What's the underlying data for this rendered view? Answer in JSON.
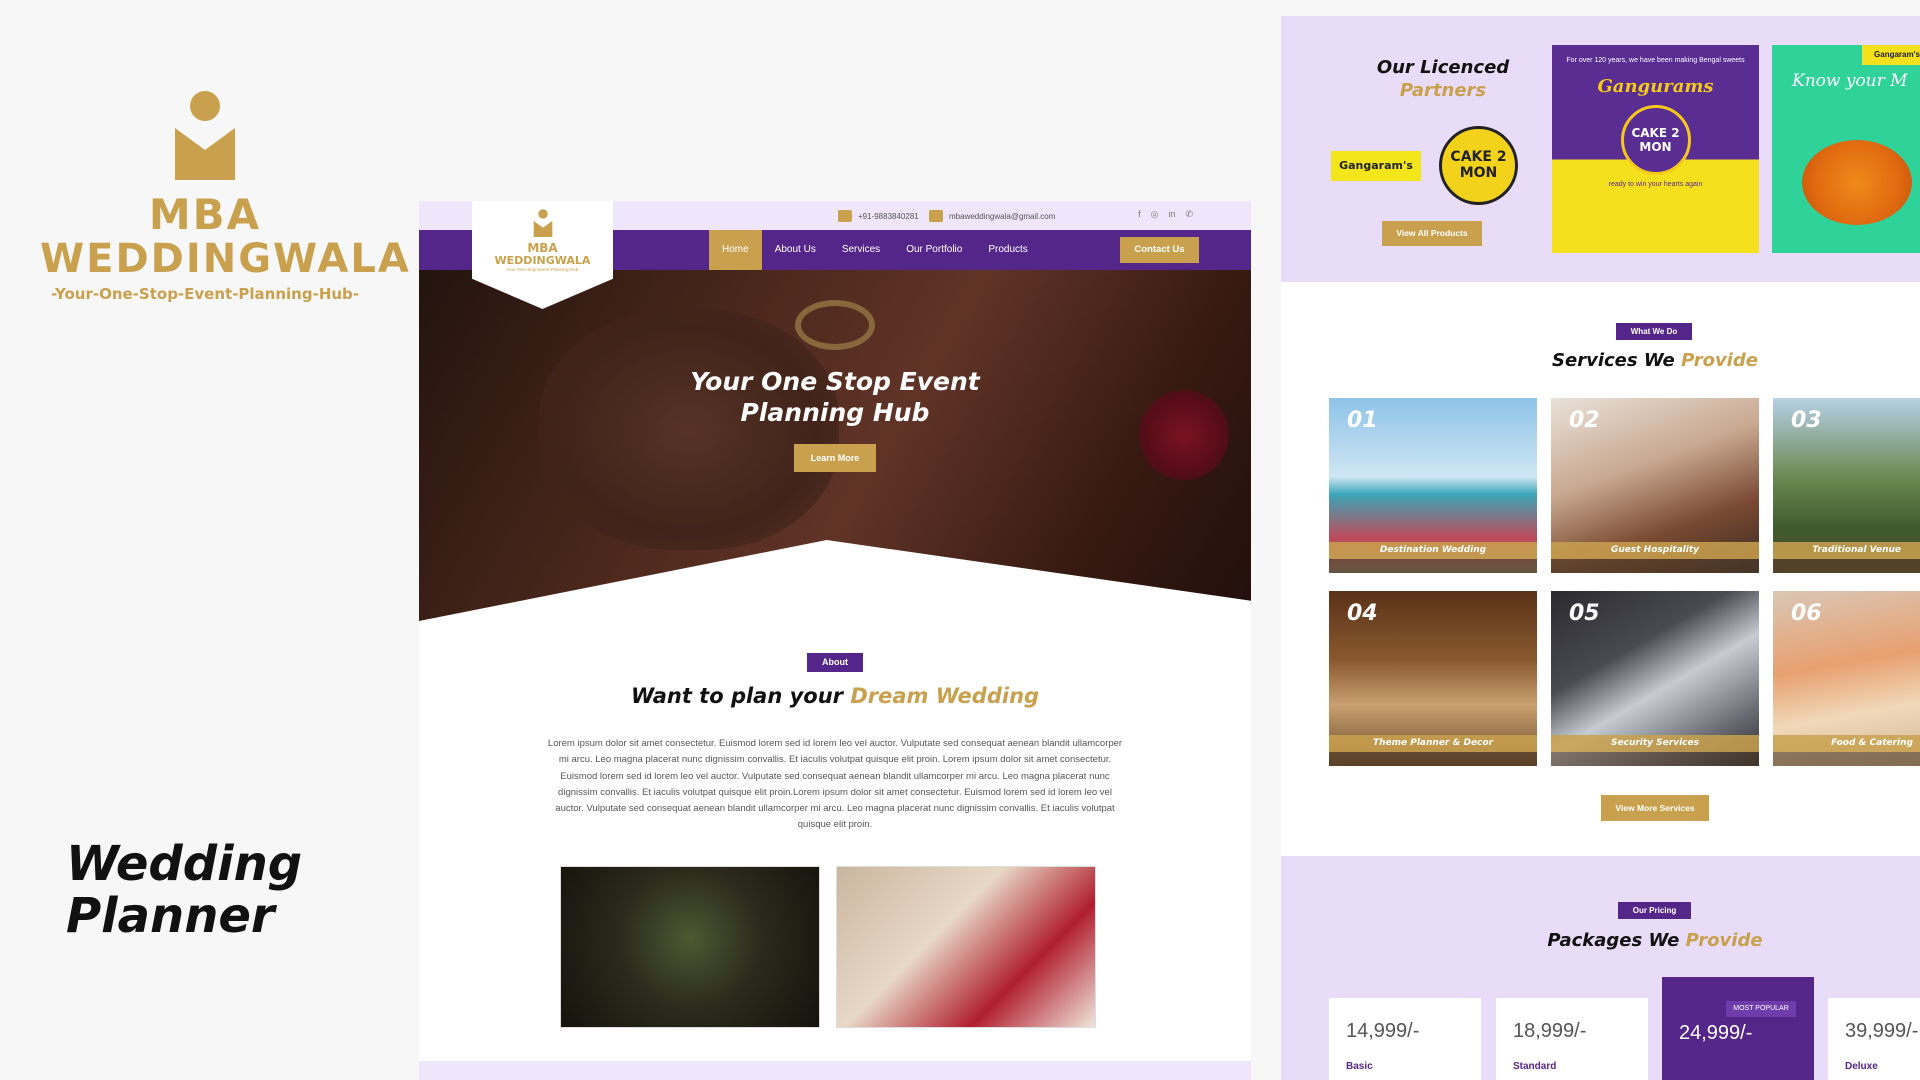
{
  "brand": {
    "logo_line1": "MBA",
    "logo_line2": "WEDDINGWALA",
    "tagline": "-Your-One-Stop-Event-Planning-Hub-",
    "showcase_title_line1": "Wedding",
    "showcase_title_line2": "Planner"
  },
  "topbar": {
    "phone": "+91-9883840281",
    "email": "mbaweddingwala@gmail.com",
    "socials": [
      "f",
      "◎",
      "in",
      "✆"
    ]
  },
  "site_logo": {
    "line1": "MBA",
    "line2": "WEDDINGWALA",
    "tagline": "-Your-One-Stop-Event-Planning-Hub-"
  },
  "nav": {
    "items": [
      "Home",
      "About Us",
      "Services",
      "Our Portfolio",
      "Products"
    ],
    "active": "Home",
    "contact_label": "Contact Us"
  },
  "hero": {
    "title": "Your One Stop Event Planning Hub",
    "button": "Learn More"
  },
  "about": {
    "pill": "About",
    "title_plain": "Want to plan your",
    "title_accent": "Dream Wedding",
    "text": "Lorem ipsum dolor sit amet consectetur. Euismod lorem sed id lorem leo vel auctor. Vulputate sed consequat aenean blandit ullamcorper mi arcu. Leo magna placerat nunc dignissim convallis. Et iaculis volutpat quisque elit proin. Lorem ipsum dolor sit amet consectetur. Euismod lorem sed id lorem leo vel auctor. Vulputate sed consequat aenean blandit ullamcorper mi arcu. Leo magna placerat nunc dignissim convallis. Et iaculis volutpat quisque elit proin.Lorem ipsum dolor sit amet consectetur. Euismod lorem sed id lorem leo vel auctor. Vulputate sed consequat aenean blandit ullamcorper mi arcu. Leo magna placerat nunc dignissim convallis. Et iaculis volutpat quisque elit proin."
  },
  "partners": {
    "title_plain": "Our Licenced",
    "title_accent": "Partners",
    "logo1": "Gangaram's",
    "logo2": "CAKE 2 MON",
    "button": "View All Products",
    "card1_text": "For over 120 years, we have been making Bengal sweets",
    "card1_name": "Gangurams",
    "card1_badge": "CAKE 2 MON",
    "card1_sub": "ready to win your hearts again",
    "card2_title": "Know your M",
    "card2_tag": "Gangaram's"
  },
  "services": {
    "pill": "What We Do",
    "title_plain": "Services We",
    "title_accent": "Provide",
    "items": [
      {
        "num": "01",
        "name": "Destination Wedding"
      },
      {
        "num": "02",
        "name": "Guest Hospitality"
      },
      {
        "num": "03",
        "name": "Traditional Venue"
      },
      {
        "num": "04",
        "name": "Theme Planner & Decor"
      },
      {
        "num": "05",
        "name": "Security Services"
      },
      {
        "num": "06",
        "name": "Food & Catering"
      }
    ],
    "button": "View More Services"
  },
  "pricing": {
    "pill": "Our Pricing",
    "title_plain": "Packages We",
    "title_accent": "Provide",
    "packages": [
      {
        "price": "14,999/-",
        "name": "Basic"
      },
      {
        "price": "18,999/-",
        "name": "Standard"
      },
      {
        "price": "24,999/-",
        "name": "",
        "badge": "MOST POPULAR"
      },
      {
        "price": "39,999/-",
        "name": "Deluxe"
      }
    ]
  },
  "colors": {
    "purple": "#55268a",
    "gold": "#c9a14e",
    "lavender": "#e8dcf8"
  }
}
